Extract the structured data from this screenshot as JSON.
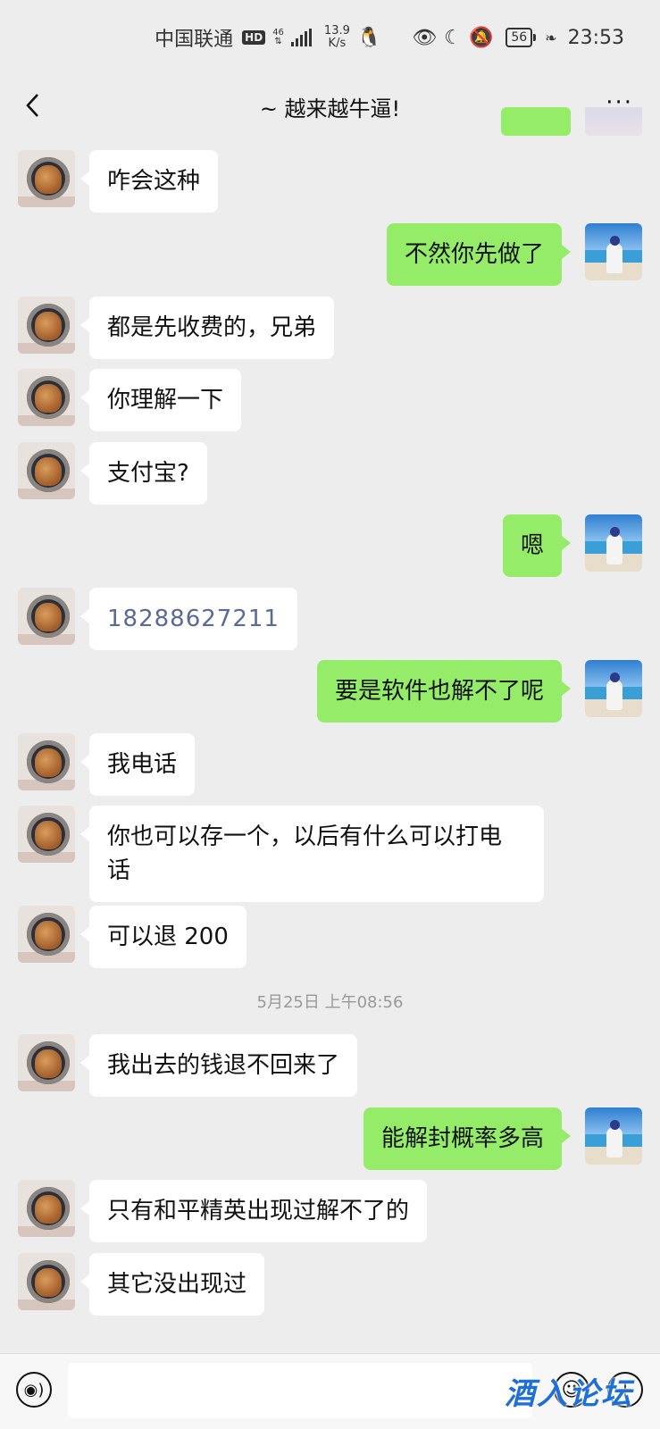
{
  "statusbar": {
    "carrier": "中国联通",
    "hd": "HD",
    "network": "46",
    "speed_value": "13.9",
    "speed_unit": "K/s",
    "battery": "56",
    "time": "23:53"
  },
  "header": {
    "title": "~ 越来越牛逼!",
    "more": "···"
  },
  "messages": [
    {
      "side": "left",
      "text": "咋会这种"
    },
    {
      "side": "right",
      "text": "不然你先做了"
    },
    {
      "side": "left",
      "text": "都是先收费的，兄弟"
    },
    {
      "side": "left",
      "text": "你理解一下"
    },
    {
      "side": "left",
      "text": "支付宝?"
    },
    {
      "side": "right",
      "text": "嗯"
    },
    {
      "side": "left",
      "text": "18288627211"
    },
    {
      "side": "right",
      "text": "要是软件也解不了呢"
    },
    {
      "side": "left",
      "text": "我电话"
    },
    {
      "side": "left",
      "text": "你也可以存一个，以后有什么可以打电\n话"
    },
    {
      "side": "left",
      "text": "可以退 200"
    },
    {
      "side": "time",
      "text": "5月25日 上午08:56"
    },
    {
      "side": "left",
      "text": "我出去的钱退不回来了"
    },
    {
      "side": "right",
      "text": "能解封概率多高"
    },
    {
      "side": "left",
      "text": "只有和平精英出现过解不了的"
    },
    {
      "side": "left",
      "text": "其它没出现过"
    }
  ],
  "inputbar": {
    "placeholder": ""
  },
  "watermark": "酒入论坛"
}
